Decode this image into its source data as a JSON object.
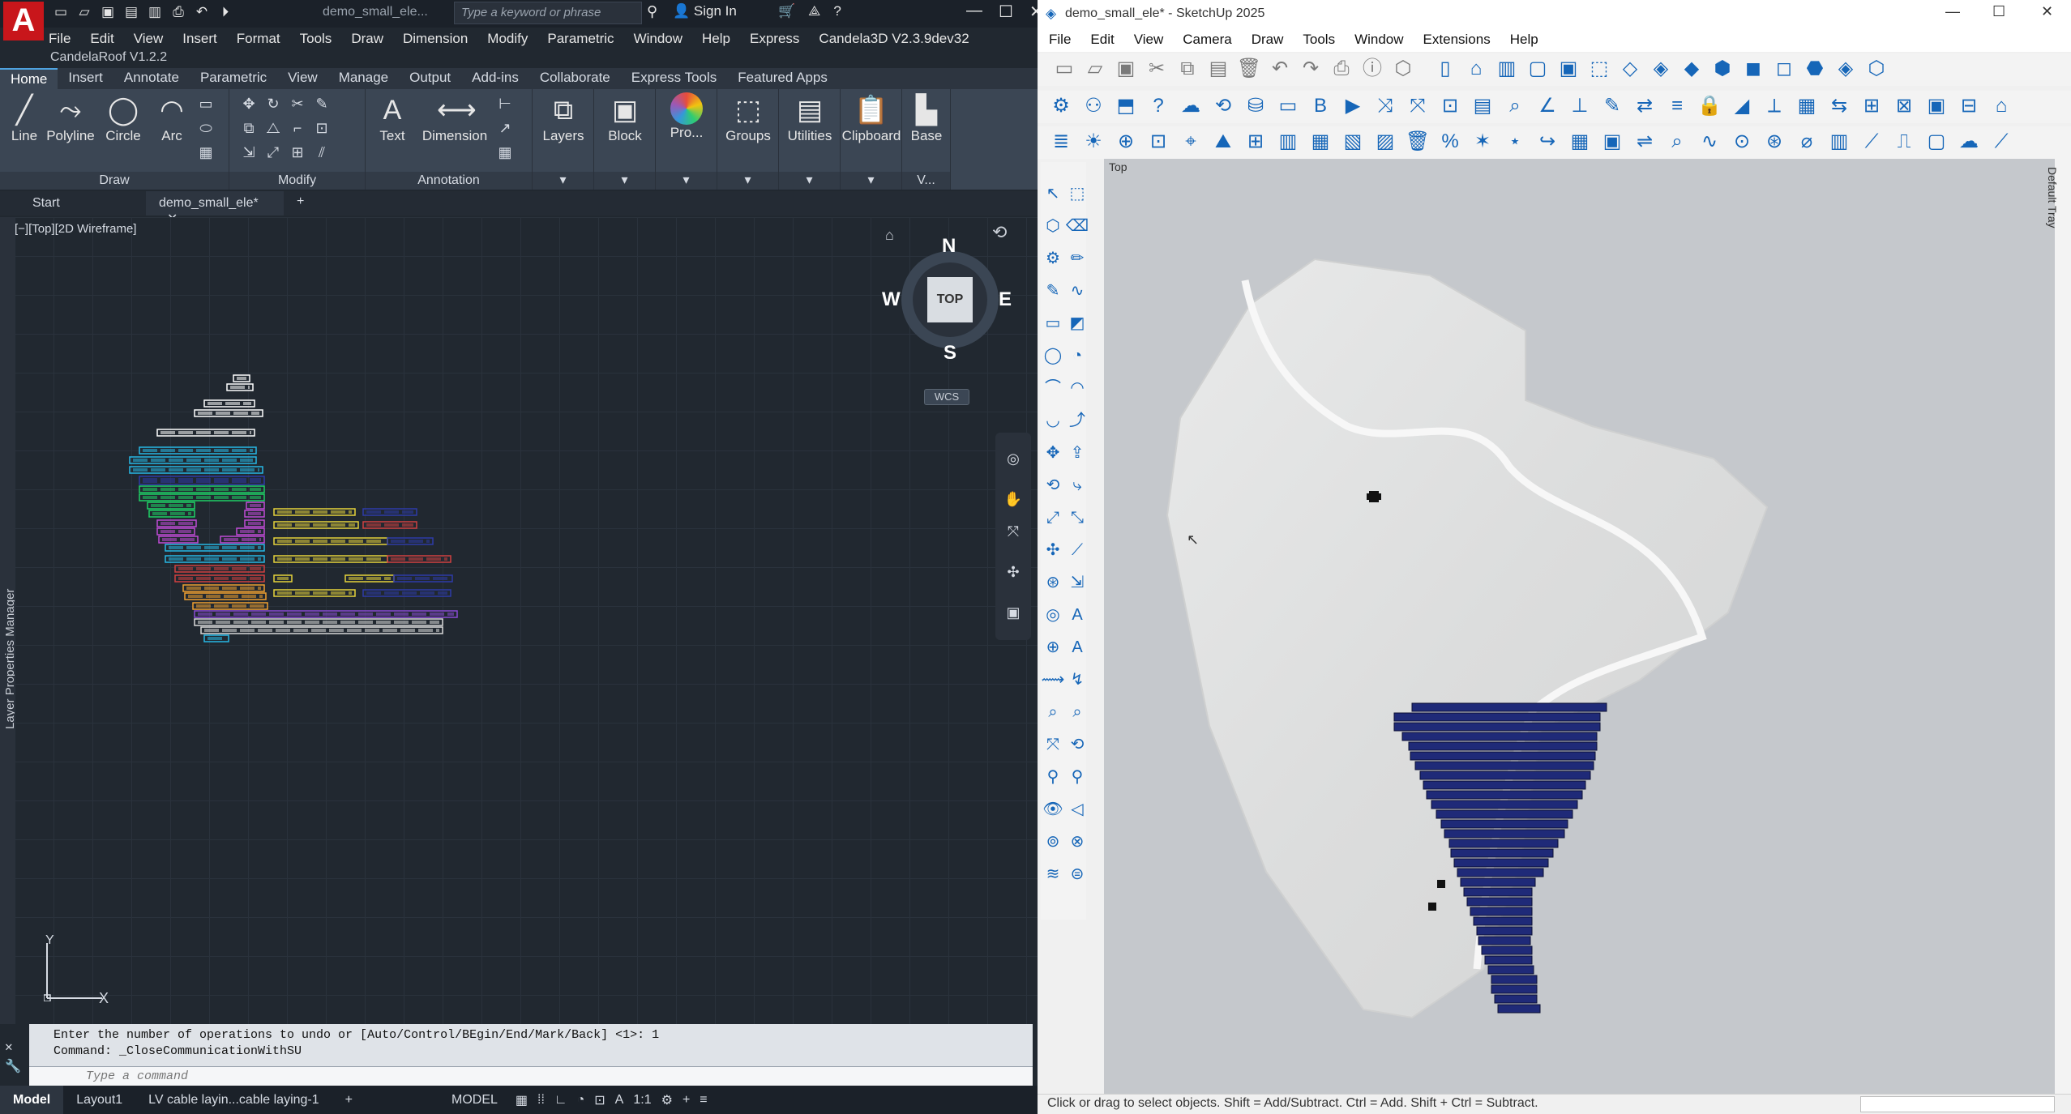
{
  "autocad": {
    "title": "demo_small_ele...",
    "search_placeholder": "Type a keyword or phrase",
    "sign_in": "Sign In",
    "plugin_label": "CandelaRoof V1.2.2",
    "menu": [
      "File",
      "Edit",
      "View",
      "Insert",
      "Format",
      "Tools",
      "Draw",
      "Dimension",
      "Modify",
      "Parametric",
      "Window",
      "Help",
      "Express",
      "Candela3D V2.3.9dev32"
    ],
    "ribbon_tabs": [
      "Home",
      "Insert",
      "Annotate",
      "Parametric",
      "View",
      "Manage",
      "Output",
      "Add-ins",
      "Collaborate",
      "Express Tools",
      "Featured Apps"
    ],
    "ribbon_tools": {
      "line": "Line",
      "polyline": "Polyline",
      "circle": "Circle",
      "arc": "Arc",
      "text": "Text",
      "dimension": "Dimension",
      "layers": "Layers",
      "block": "Block",
      "properties": "Pro...",
      "groups": "Groups",
      "utilities": "Utilities",
      "clipboard": "Clipboard",
      "base": "Base"
    },
    "panel_titles": {
      "draw": "Draw",
      "modify": "Modify",
      "annotation": "Annotation",
      "view": "V..."
    },
    "doc_tabs": {
      "start": "Start",
      "active": "demo_small_ele*"
    },
    "viewport_label": "[−][Top][2D Wireframe]",
    "layer_manager_label": "Layer Properties Manager",
    "viewcube": {
      "top": "TOP",
      "n": "N",
      "s": "S",
      "e": "E",
      "w": "W",
      "wcs": "WCS"
    },
    "ucs": {
      "x": "X",
      "y": "Y"
    },
    "command_history": [
      "Enter the number of operations to undo or [Auto/Control/BEgin/End/Mark/Back] <1>: 1",
      "Command: _CloseCommunicationWithSU"
    ],
    "command_placeholder": "Type a command",
    "status_tabs": {
      "model": "Model",
      "layout1": "Layout1",
      "layout2": "LV cable layin...cable laying-1"
    },
    "status_model": "MODEL",
    "status_scale": "1:1"
  },
  "sketchup": {
    "title": "demo_small_ele* - SketchUp 2025",
    "menu": [
      "File",
      "Edit",
      "View",
      "Camera",
      "Draw",
      "Tools",
      "Window",
      "Extensions",
      "Help"
    ],
    "viewport_label": "Top",
    "tray_label": "Default Tray",
    "status_text": "Click or drag to select objects. Shift = Add/Subtract. Ctrl = Add. Shift + Ctrl = Subtract."
  },
  "colors": {
    "acad_bg": "#212830",
    "acad_ribbon": "#3b4654",
    "su_viewport": "#c5c8cc",
    "panel_navy": "#1f2a78",
    "road": "#f5f5f5"
  }
}
